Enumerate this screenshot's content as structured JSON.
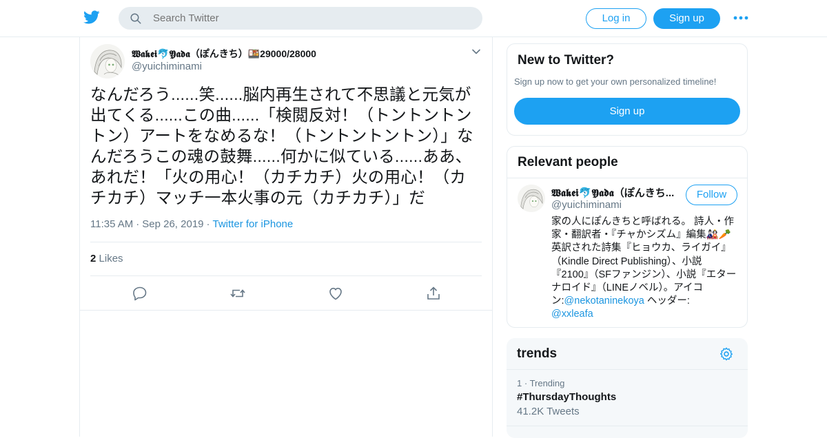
{
  "header": {
    "search_placeholder": "Search Twitter",
    "login_label": "Log in",
    "signup_label": "Sign up",
    "brand_color": "#1da1f2"
  },
  "tweet": {
    "author_name": "𝖂𝖆𝖐𝖊𝖎🐬𝖄𝖆𝖉𝖆（ぽんきち）🍱29000/28000",
    "author_handle": "@yuichiminami",
    "text": "なんだろう......笑......脳内再生されて不思議と元気が出てくる......この曲......「検閲反対！（トントントントン）アートをなめるな！（トントントントン）」なんだろうこの魂の鼓舞......何かに似ている......ああ、あれだ！「火の用心！（カチカチ）火の用心！（カチカチ）マッチ一本火事の元（カチカチ）」だ",
    "time": "11:35 AM",
    "date": "Sep 26, 2019",
    "source": "Twitter for iPhone",
    "likes_count": "2",
    "likes_label": "Likes"
  },
  "new_to_twitter": {
    "title": "New to Twitter?",
    "subtitle": "Sign up now to get your own personalized timeline!",
    "button": "Sign up"
  },
  "relevant_people": {
    "title": "Relevant people",
    "name": "𝖂𝖆𝖐𝖊𝖎🐬𝖄𝖆𝖉𝖆（ぽんきち...",
    "handle": "@yuichiminami",
    "follow": "Follow",
    "bio_text": "家の人にぽんきちと呼ばれる。 詩人・作家・翻訳者・『チャかシズム』編集🎎🥕英訳された詩集『ヒョウカ、ライガイ』（Kindle Direct Publishing）、小説『2100』（SFファンジン）、小説『エターナロイド』（LINEノベル）。アイコン:",
    "bio_mention1": "@nekotaninekoya",
    "bio_mid": " ヘッダー:",
    "bio_mention2": "@xxleafa"
  },
  "trends": {
    "title": "trends",
    "items": [
      {
        "rank": "1",
        "meta": "Trending",
        "tag": "#ThursdayThoughts",
        "count": "41.2K Tweets"
      }
    ]
  }
}
